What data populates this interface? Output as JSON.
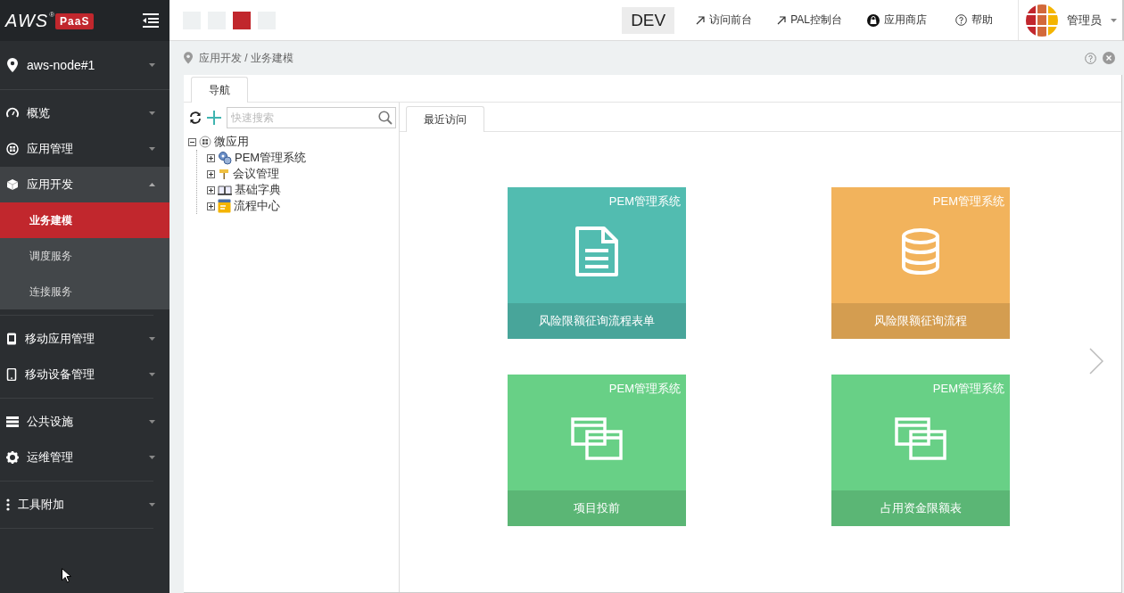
{
  "brand": {
    "logo": "AWS",
    "registered": "®",
    "product": "PaaS"
  },
  "node": {
    "label": "aws-node#1"
  },
  "sidebar": {
    "sections": [
      [
        {
          "label": "概览",
          "kind": "gauge",
          "expanded": false,
          "selected": false
        },
        {
          "label": "应用管理",
          "kind": "apps",
          "expanded": false,
          "selected": false
        },
        {
          "label": "应用开发",
          "kind": "cube",
          "expanded": true,
          "selected": false
        },
        {
          "label": "业务建模",
          "kind": "sub",
          "selected": true
        },
        {
          "label": "调度服务",
          "kind": "sub",
          "selected": false
        },
        {
          "label": "连接服务",
          "kind": "sub",
          "selected": false
        }
      ],
      [
        {
          "label": "移动应用管理",
          "kind": "tablet",
          "expanded": false,
          "selected": false
        },
        {
          "label": "移动设备管理",
          "kind": "phone",
          "expanded": false,
          "selected": false
        }
      ],
      [
        {
          "label": "公共设施",
          "kind": "bars",
          "expanded": false,
          "selected": false
        },
        {
          "label": "运维管理",
          "kind": "gear",
          "expanded": false,
          "selected": false
        }
      ],
      [
        {
          "label": "工具附加",
          "kind": "dots",
          "expanded": false,
          "selected": false
        }
      ]
    ]
  },
  "header": {
    "swatches": [
      {
        "selected": false
      },
      {
        "selected": false
      },
      {
        "selected": true
      },
      {
        "selected": false
      }
    ],
    "env": "DEV",
    "links": [
      {
        "label": "访问前台",
        "kind": "arrow"
      },
      {
        "label": "PAL控制台",
        "kind": "arrow"
      },
      {
        "label": "应用商店",
        "kind": "bag"
      },
      {
        "label": "帮助",
        "kind": "help"
      }
    ],
    "user": "管理员"
  },
  "breadcrumb": "应用开发 / 业务建模",
  "nav_tab": {
    "label": "导航",
    "selected": true
  },
  "search": {
    "placeholder": "快速搜索"
  },
  "tree": [
    {
      "label": "微应用",
      "kind": "apps",
      "expanded": true,
      "children": [
        {
          "label": "PEM管理系统",
          "kind": "gears",
          "expanded": false
        },
        {
          "label": "会议管理",
          "kind": "sign",
          "expanded": false
        },
        {
          "label": "基础字典",
          "kind": "book",
          "expanded": false
        },
        {
          "label": "流程中心",
          "kind": "form",
          "expanded": false
        }
      ]
    }
  ],
  "recent_tab": {
    "label": "最近访问",
    "selected": true
  },
  "tiles": [
    {
      "system": "PEM管理系统",
      "title": "风险限额征询流程表单",
      "kind": "document",
      "color": "#52bcb0"
    },
    {
      "system": "PEM管理系统",
      "title": "风险限额征询流程",
      "kind": "database",
      "color": "#f2b35c"
    },
    {
      "system": "PEM管理系统",
      "title": "项目投前",
      "kind": "windows",
      "color": "#68d086"
    },
    {
      "system": "PEM管理系统",
      "title": "占用资金限额表",
      "kind": "windows",
      "color": "#68d086"
    }
  ]
}
